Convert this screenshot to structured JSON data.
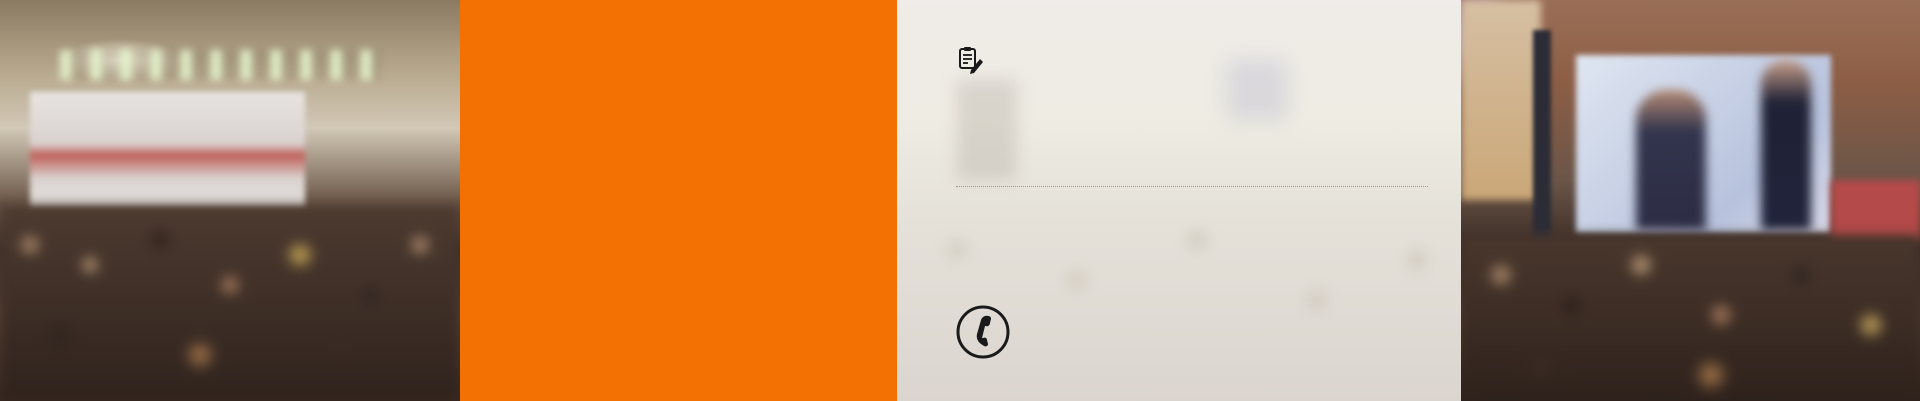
{
  "banner": {
    "panels": {
      "left_photo": "conference-audience-photo",
      "accent_block_color": "#f27102",
      "content_panel": "faded-audience-overlay",
      "right_photo": "speaker-on-screen-photo"
    },
    "icons": {
      "note": "note-pen-icon",
      "phone": "phone-circle-icon"
    },
    "colors": {
      "accent": "#f27102",
      "icon": "#1a1a1a",
      "divider": "#9c9890"
    }
  }
}
